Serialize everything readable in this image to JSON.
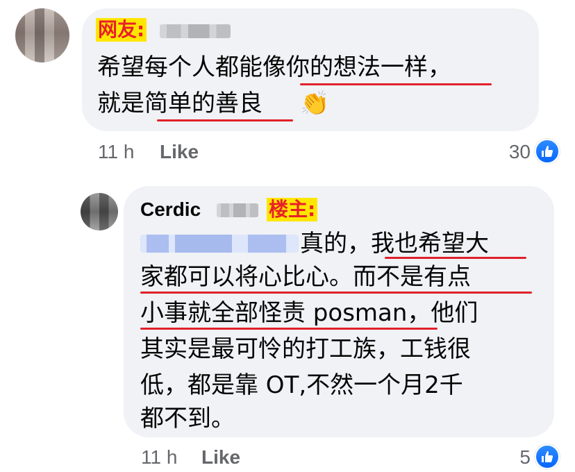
{
  "comment_1": {
    "label": "网友:",
    "text_line_1": "希望每个人都能像你的想法一样，",
    "text_line_2": "就是简单的善良",
    "emoji": "👏",
    "time": "11 h",
    "like_action": "Like",
    "reaction_count": "30",
    "reaction_icon": "like-icon"
  },
  "comment_2": {
    "author": "Cerdic",
    "label": "楼主:",
    "text_line_1": "真的，我也希望大",
    "text_line_2": "家都可以将心比心。而不是有点",
    "text_line_3": "小事就全部怪责 posman，他们",
    "text_line_4": "其实是最可怜的打工族，工钱很",
    "text_line_5": "低，都是靠 OT,不然一个月2千",
    "text_line_6": "都不到。",
    "time": "11 h",
    "like_action": "Like",
    "reaction_count": "5",
    "reaction_icon": "like-icon"
  },
  "colors": {
    "bubble_bg": "#f0f2f5",
    "label_text": "#e8202a",
    "label_highlight": "#ffe600",
    "underline": "#e0202a",
    "meta_text": "#65676b",
    "like_blue": "#0866ff"
  }
}
